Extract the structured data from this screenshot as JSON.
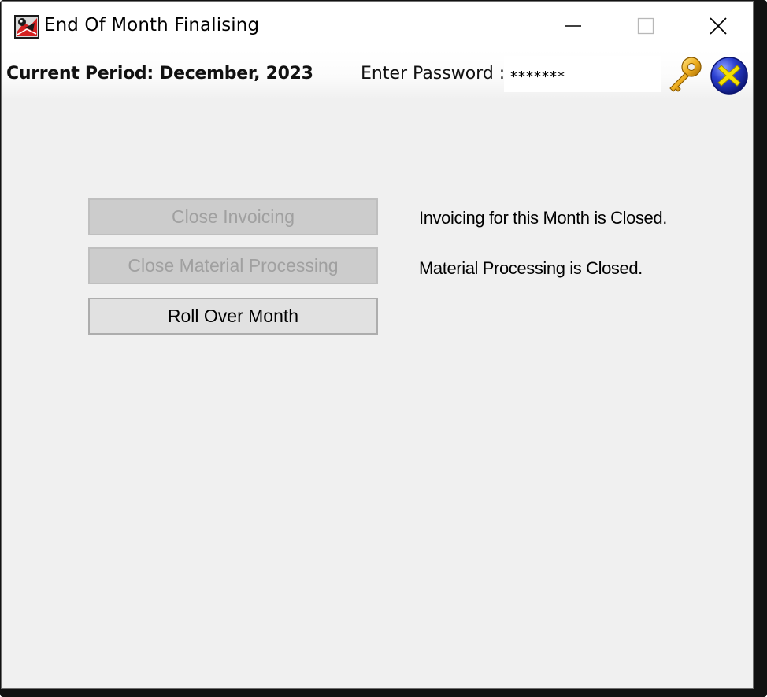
{
  "window": {
    "title": "End Of Month Finalising",
    "controls": {
      "minimize": "minimize",
      "maximize": "maximize",
      "close": "close"
    }
  },
  "header": {
    "current_period": "Current Period: December, 2023",
    "password_label": "Enter Password :",
    "password_value": "*******"
  },
  "actions": [
    {
      "label": "Close Invoicing",
      "enabled": false
    },
    {
      "label": "Close Material Processing",
      "enabled": false
    },
    {
      "label": "Roll Over Month",
      "enabled": true
    }
  ],
  "status": {
    "invoicing": "Invoicing for this Month is Closed.",
    "material": "Material Processing is Closed."
  },
  "icons": {
    "app": "app-logo-icon",
    "confirm": "key-icon",
    "cancel": "cancel-x-icon"
  },
  "colors": {
    "window_bg": "#f0f0f0",
    "disabled_button_bg": "#cccccc",
    "disabled_text": "#a0a0a0",
    "button_bg": "#e1e1e1",
    "key_gold": "#e0a020",
    "cancel_blue": "#1a2fc0",
    "cancel_yellow": "#f5e000"
  }
}
